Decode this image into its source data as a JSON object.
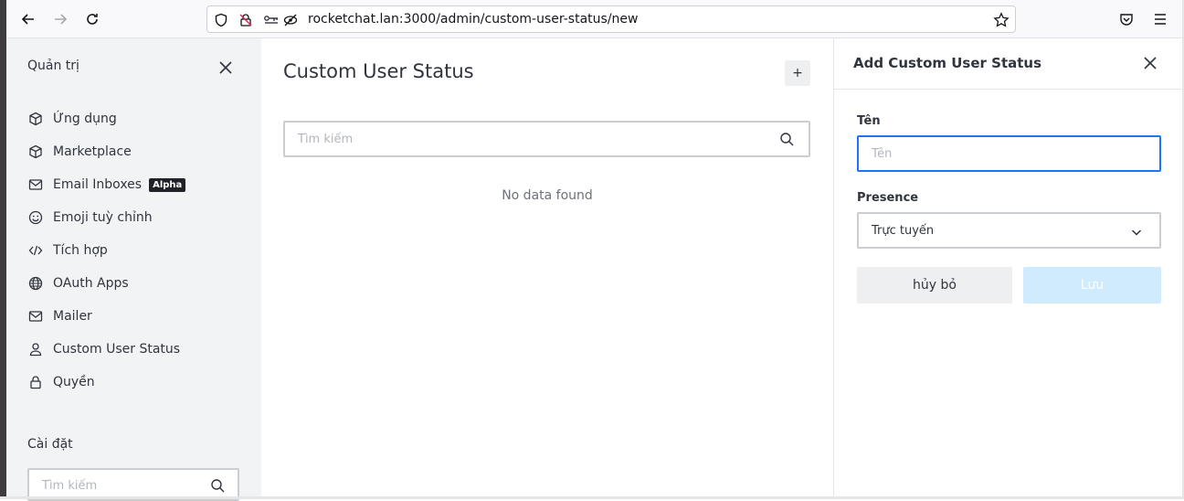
{
  "browser": {
    "url": "rocketchat.lan:3000/admin/custom-user-status/new"
  },
  "sidebar": {
    "title": "Quản trị",
    "items": [
      {
        "label": "Ứng dụng",
        "icon": "cube-icon"
      },
      {
        "label": "Marketplace",
        "icon": "cube-icon"
      },
      {
        "label": "Email Inboxes",
        "icon": "mail-icon",
        "badge": "Alpha"
      },
      {
        "label": "Emoji tuỳ chỉnh",
        "icon": "emoji-icon"
      },
      {
        "label": "Tích hợp",
        "icon": "code-icon"
      },
      {
        "label": "OAuth Apps",
        "icon": "globe-icon"
      },
      {
        "label": "Mailer",
        "icon": "mail-icon"
      },
      {
        "label": "Custom User Status",
        "icon": "user-icon"
      },
      {
        "label": "Quyền",
        "icon": "lock-icon"
      }
    ],
    "settings_title": "Cài đặt",
    "settings_search_placeholder": "Tìm kiếm"
  },
  "main": {
    "title": "Custom User Status",
    "add_label": "+",
    "search_placeholder": "Tìm kiếm",
    "empty_text": "No data found"
  },
  "panel": {
    "title": "Add Custom User Status",
    "name_label": "Tên",
    "name_placeholder": "Tên",
    "presence_label": "Presence",
    "presence_value": "Trực tuyến",
    "cancel_label": "hủy bỏ",
    "save_label": "Lưu"
  },
  "colors": {
    "accent": "#1d74f5",
    "save_disabled_bg": "#d1ebfe",
    "sidebar_bg": "#f2f3f5"
  }
}
